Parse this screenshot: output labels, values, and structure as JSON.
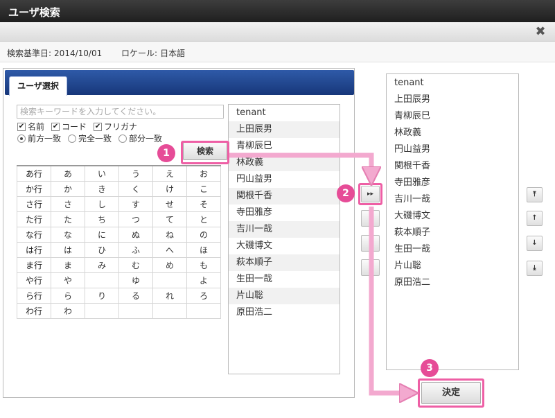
{
  "window": {
    "title": "ユーザ検索",
    "close_icon": "✖"
  },
  "info": {
    "base_date_label": "検索基準日:",
    "base_date": "2014/10/01",
    "locale_label": "ロケール:",
    "locale": "日本語"
  },
  "tab": {
    "label": "ユーザ選択"
  },
  "search": {
    "placeholder": "検索キーワードを入力してください。",
    "checkboxes": [
      "名前",
      "コード",
      "フリガナ"
    ],
    "radios": [
      "前方一致",
      "完全一致",
      "部分一致"
    ],
    "button_label": "検索"
  },
  "kana_rows": [
    [
      "あ行",
      "あ",
      "い",
      "う",
      "え",
      "お"
    ],
    [
      "か行",
      "か",
      "き",
      "く",
      "け",
      "こ"
    ],
    [
      "さ行",
      "さ",
      "し",
      "す",
      "せ",
      "そ"
    ],
    [
      "た行",
      "た",
      "ち",
      "つ",
      "て",
      "と"
    ],
    [
      "な行",
      "な",
      "に",
      "ぬ",
      "ね",
      "の"
    ],
    [
      "は行",
      "は",
      "ひ",
      "ふ",
      "へ",
      "ほ"
    ],
    [
      "ま行",
      "ま",
      "み",
      "む",
      "め",
      "も"
    ],
    [
      "や行",
      "や",
      "",
      "ゆ",
      "",
      "よ"
    ],
    [
      "ら行",
      "ら",
      "り",
      "る",
      "れ",
      "ろ"
    ],
    [
      "わ行",
      "わ",
      "",
      "",
      "",
      ""
    ]
  ],
  "users": [
    "tenant",
    "上田辰男",
    "青柳辰巳",
    "林政義",
    "円山益男",
    "関根千香",
    "寺田雅彦",
    "吉川一哉",
    "大磯博文",
    "萩本順子",
    "生田一哉",
    "片山聡",
    "原田浩二"
  ],
  "selected_users": [
    "tenant",
    "上田辰男",
    "青柳辰巳",
    "林政義",
    "円山益男",
    "関根千香",
    "寺田雅彦",
    "吉川一哉",
    "大磯博文",
    "萩本順子",
    "生田一哉",
    "片山聡",
    "原田浩二"
  ],
  "transfer_button_label": "▸▸",
  "order_buttons": [
    "⤒",
    "↑",
    "↓",
    "⤓"
  ],
  "ok_button_label": "決定",
  "badges": [
    "1",
    "2",
    "3"
  ],
  "accent_color": "#e64c97"
}
